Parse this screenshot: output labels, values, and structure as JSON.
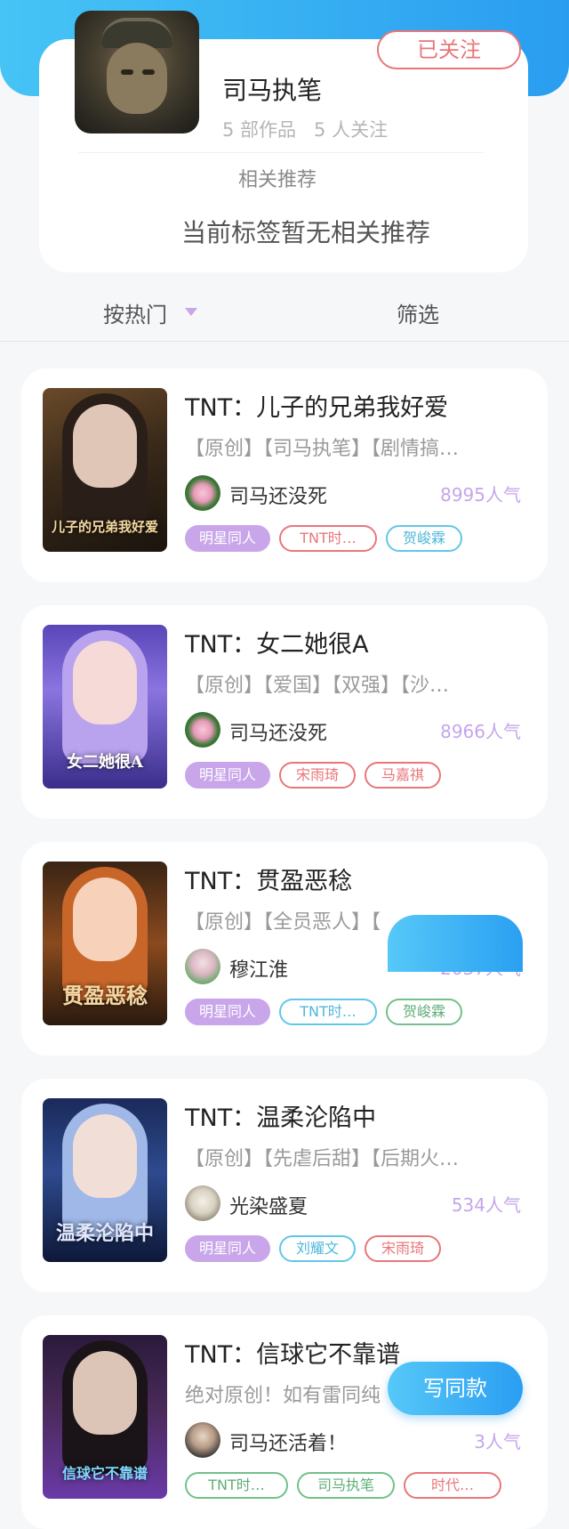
{
  "profile": {
    "name": "司马执笔",
    "works": "5 部作品",
    "follows": "5 人关注",
    "follow_button": "已关注",
    "rec_title": "相关推荐",
    "rec_empty": "当前标签暂无相关推荐"
  },
  "sort_bar": {
    "hot_label": "按热门",
    "filter_label": "筛选"
  },
  "books": [
    {
      "title": "TNT：儿子的兄弟我好爱",
      "tags": "【原创】【司马执笔】【剧情搞…",
      "author": "司马还没死",
      "popularity": "8995人气",
      "cover_text": "儿子的兄弟我好爱",
      "chips": [
        "明星同人",
        "TNT时…",
        "贺峻霖"
      ]
    },
    {
      "title": "TNT：女二她很A",
      "tags": "【原创】【爱国】【双强】【沙…",
      "author": "司马还没死",
      "popularity": "8966人气",
      "cover_text": "女二她很A",
      "chips": [
        "明星同人",
        "宋雨琦",
        "马嘉祺"
      ]
    },
    {
      "title": "TNT：贯盈恶稔",
      "tags": "【原创】【全员恶人】【",
      "author": "穆江淮",
      "popularity": "2037人气",
      "cover_text": "贯盈恶稔",
      "chips": [
        "明星同人",
        "TNT时…",
        "贺峻霖"
      ]
    },
    {
      "title": "TNT：温柔沦陷中",
      "tags": "【原创】【先虐后甜】【后期火…",
      "author": "光染盛夏",
      "popularity": "534人气",
      "cover_text": "温柔沦陷中",
      "chips": [
        "明星同人",
        "刘耀文",
        "宋雨琦"
      ]
    },
    {
      "title": "TNT：信球它不靠谱",
      "tags": "绝对原创！如有雷同纯",
      "author": "司马还活着！",
      "popularity": "3人气",
      "cover_text": "信球它不靠谱",
      "chips": [
        "TNT时…",
        "司马执笔",
        "时代…"
      ]
    }
  ],
  "write_button": "写同款",
  "colors": {
    "accent_blue": "#2a9df0",
    "follow_red": "#e9767a",
    "chip_purple": "#c9a6ea",
    "popularity_purple": "#c5a6ec"
  }
}
